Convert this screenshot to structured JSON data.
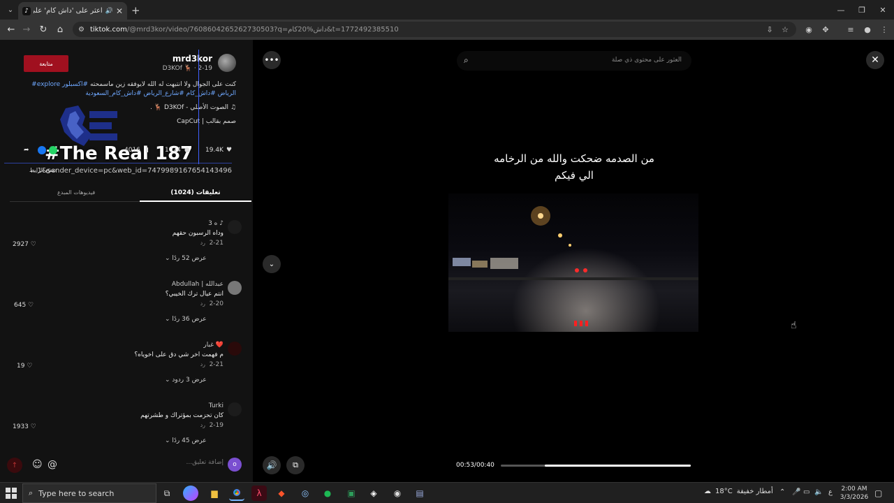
{
  "browser": {
    "tab_title": "اعثر على 'داش كام' على TikTok",
    "url_host": "tiktok.com",
    "url_path": "/@mrd3kor/video/7608604265262730503?q=داش%20كام&t=1772492385510",
    "new_tab_label": "+"
  },
  "post": {
    "username": "mrd3kor",
    "sub": "D3KOf 🦌 · 2-19",
    "follow_label": "متابعة",
    "description": "كنت على الجوال ولا انتبهت له الله لايوفقه زين ماسمحته",
    "tags": "#اكسبلور explore# الرياض #داش_كام #شارع_الرياض #داش_كام_السعودية",
    "music": "الصوت الأصلي - D3KOf 🦌 .",
    "capcut": "CapCut | صمم بقالب",
    "overlay_text": "#The Real 187",
    "likes": "19.4K",
    "comments_count": "1024",
    "saves": "4016",
    "copy_link_label": "نسخ الرابط",
    "link_text": "...1&sender_device=pc&web_id=7479989167654143496",
    "tab_creator": "فيديوهات المبدع",
    "tab_comments": "(1024) تعليقات"
  },
  "comments": [
    {
      "name": "3 ه ♪",
      "text": "وداه الرسبون حقهم",
      "date": "2-21",
      "reply": "رد",
      "likes": "2927",
      "show": "عرض 52 ردًا"
    },
    {
      "name": "Abdullah | عبدالله",
      "text": "انتم عيال ترك الخيبي؟",
      "date": "2-20",
      "reply": "رد",
      "likes": "645",
      "show": "عرض 36 ردًا"
    },
    {
      "name": "غبار ❤️",
      "text": "م فهمت اخر شي دق على اخوياه؟",
      "date": "2-21",
      "reply": "رد",
      "likes": "19",
      "show": "عرض 3 ردود"
    },
    {
      "name": "Turki",
      "text": "كان تحزمت بمؤتراك و طشرتهم",
      "date": "2-19",
      "reply": "رد",
      "likes": "1933",
      "show": "عرض 45 ردًا"
    }
  ],
  "compose": {
    "placeholder": "إضافة تعليق...",
    "me_initial": "o"
  },
  "player": {
    "search_placeholder": "العثور على محتوى ذي صلة",
    "caption": "من الصدمه ضحكت والله من الرخامه الي فيكم",
    "time": "00:53/00:40",
    "progress": 0.23
  },
  "taskbar": {
    "search_placeholder": "Type here to search",
    "temperature": "18°C",
    "weather": "أمطار خفيفة",
    "lang": "ع",
    "time": "2:00 AM",
    "date": "3/3/2026"
  }
}
